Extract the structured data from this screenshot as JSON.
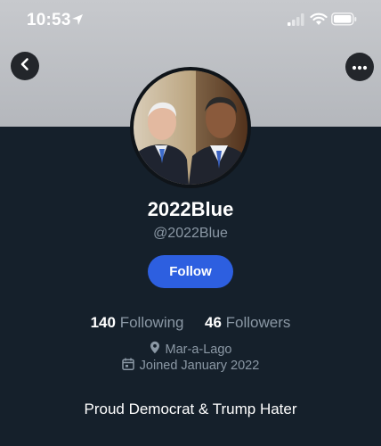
{
  "status_bar": {
    "time": "10:53",
    "icons": [
      "location-arrow-icon",
      "cellular-signal-icon",
      "wifi-icon",
      "battery-icon"
    ]
  },
  "nav": {
    "back_icon": "chevron-left-icon",
    "more_icon": "more-dots-icon"
  },
  "profile": {
    "display_name": "2022Blue",
    "handle": "@2022Blue",
    "follow_label": "Follow",
    "following_count": "140",
    "following_label": "Following",
    "followers_count": "46",
    "followers_label": "Followers",
    "location": "Mar-a-Lago",
    "joined": "Joined January 2022",
    "bio": "Proud Democrat & Trump Hater"
  },
  "colors": {
    "background": "#15202b",
    "header": "#c7c9cd",
    "accent": "#2d5fe0",
    "secondary_text": "#8b98a5"
  }
}
